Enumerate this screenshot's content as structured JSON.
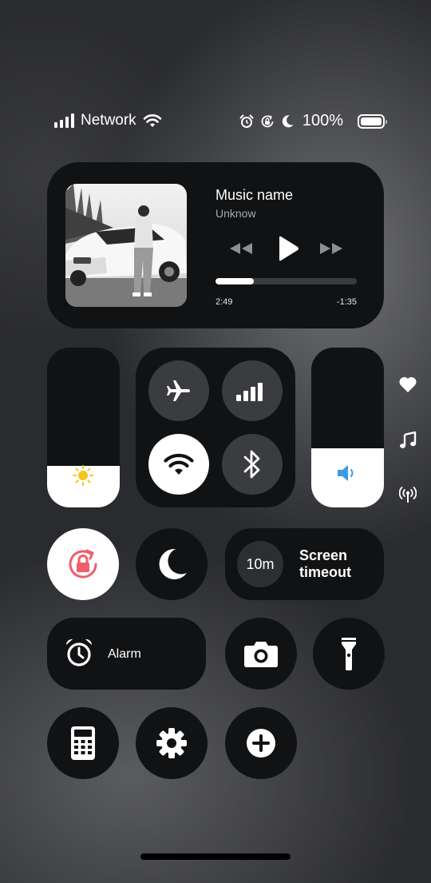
{
  "status_bar": {
    "carrier": "Network",
    "battery_percent": "100%",
    "icons": [
      "signal-bars-icon",
      "wifi-icon",
      "alarm-icon",
      "rotation-lock-icon",
      "moon-icon",
      "battery-icon"
    ]
  },
  "now_playing": {
    "title": "Music name",
    "artist": "Unknow",
    "elapsed": "2:49",
    "remaining": "-1:35",
    "progress": 0.27,
    "controls": [
      "rewind-icon",
      "play-icon",
      "fast-forward-icon"
    ]
  },
  "brightness": {
    "level": 0.26,
    "icon": "sun-icon",
    "icon_color": "#f5c518"
  },
  "connectivity": {
    "airplane": {
      "icon": "airplane-icon",
      "on": false
    },
    "cellular": {
      "icon": "cellular-icon",
      "on": false
    },
    "wifi": {
      "icon": "wifi-icon",
      "on": true
    },
    "bluetooth": {
      "icon": "bluetooth-icon",
      "on": false
    }
  },
  "volume": {
    "level": 0.37,
    "icon": "speaker-icon",
    "icon_color": "#3b9be0"
  },
  "side_icons": [
    "heart-icon",
    "music-note-icon",
    "broadcast-icon"
  ],
  "toggles": {
    "rotation_lock": {
      "on": true,
      "icon": "rotation-lock-icon",
      "color": "#ef5f6b"
    },
    "do_not_disturb": {
      "on": false,
      "icon": "moon-icon"
    },
    "screen_timeout": {
      "value": "10m",
      "label": "Screen timeout"
    },
    "alarm": {
      "label": "Alarm",
      "icon": "alarm-clock-icon"
    },
    "camera": {
      "icon": "camera-icon"
    },
    "flashlight": {
      "icon": "flashlight-icon"
    },
    "calculator": {
      "icon": "calculator-icon"
    },
    "settings": {
      "icon": "gear-icon"
    },
    "add": {
      "icon": "plus-circle-icon"
    }
  },
  "colors": {
    "tile": "#111214",
    "tile_button": "#3b3c40",
    "accent_red": "#ef5f6b",
    "accent_blue": "#3b9be0",
    "accent_yellow": "#f5c518"
  }
}
